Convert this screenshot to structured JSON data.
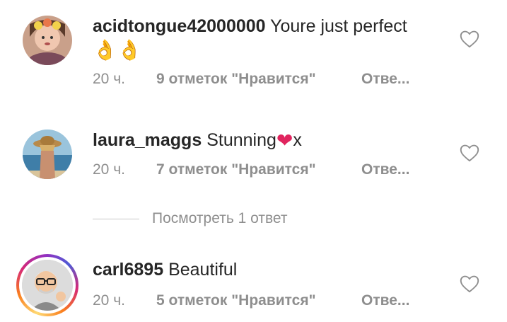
{
  "comments": [
    {
      "username": "acidtongue42000000",
      "text": "Youre just perfect",
      "emoji": "👌👌",
      "time": "20 ч.",
      "likes": "9 отметок \"Нравится\"",
      "reply": "Отве..."
    },
    {
      "username": "laura_maggs",
      "text": "Stunning",
      "emoji_heart": "❤",
      "text_after": "x",
      "time": "20 ч.",
      "likes": "7 отметок \"Нравится\"",
      "reply": "Отве..."
    },
    {
      "username": "carl6895",
      "text": "Beautiful",
      "time": "20 ч.",
      "likes": "5 отметок \"Нравится\"",
      "reply": "Отве..."
    }
  ],
  "view_replies": "Посмотреть 1 ответ",
  "icons": {
    "like": "heart-outline-icon"
  },
  "colors": {
    "text": "#262626",
    "secondary": "#8e8e8e",
    "story_ring": [
      "#feda75",
      "#fa7e1e",
      "#d62976",
      "#962fbf",
      "#4f5bd5"
    ]
  }
}
